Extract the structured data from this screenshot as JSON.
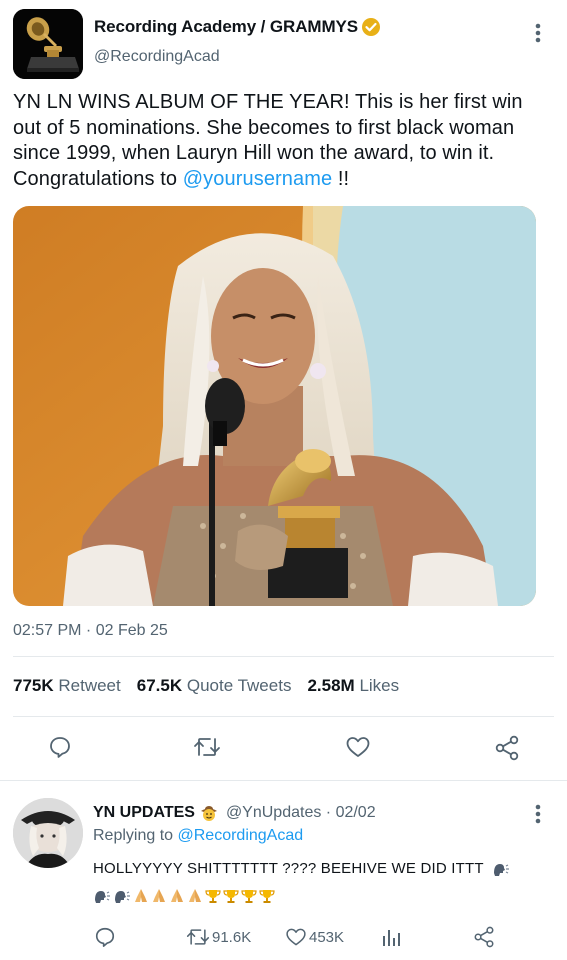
{
  "tweet": {
    "author": {
      "name": "Recording Academy / GRAMMYS",
      "handle": "@RecordingAcad",
      "verified": true,
      "avatar_icon": "grammy-trophy-icon"
    },
    "text_part1": "YN LN WINS ALBUM OF THE YEAR! This is her first win out of 5 nominations. She becomes to first black woman since 1999, when Lauryn Hill won the award, to win it. Congratulations to ",
    "mention": "@yourusername",
    "text_part2": " !!",
    "timestamp": "02:57 PM · 02 Feb 25",
    "stats": {
      "retweets": "775K",
      "retweets_label": "Retweet",
      "quotes": "67.5K",
      "quotes_label": "Quote Tweets",
      "likes": "2.58M",
      "likes_label": "Likes"
    },
    "actions": [
      "reply-icon",
      "retweet-icon",
      "like-icon",
      "share-icon"
    ]
  },
  "reply": {
    "name": "YN UPDATES",
    "name_emoji": "cowboy-emoji",
    "handle": "@YnUpdates",
    "date": "02/02",
    "meta": "@YnUpdates · 02/02",
    "replying_prefix": "Replying to ",
    "replying_to": "@RecordingAcad",
    "text": "HOLLYYYYY SHITTTTTTT ???? BEEHIVE WE DID ITTT",
    "emojis": [
      "speaking-head",
      "speaking-head",
      "speaking-head",
      "folded-hands",
      "folded-hands",
      "folded-hands",
      "folded-hands",
      "trophy",
      "trophy",
      "trophy",
      "trophy"
    ],
    "actions": {
      "retweets": "91.6K",
      "likes": "453K"
    }
  },
  "colors": {
    "accent": "#1d9bf0",
    "text": "#0f1419",
    "secondary": "#536471",
    "verified_gold": "#e8b017",
    "divider": "#e5e9ec"
  }
}
